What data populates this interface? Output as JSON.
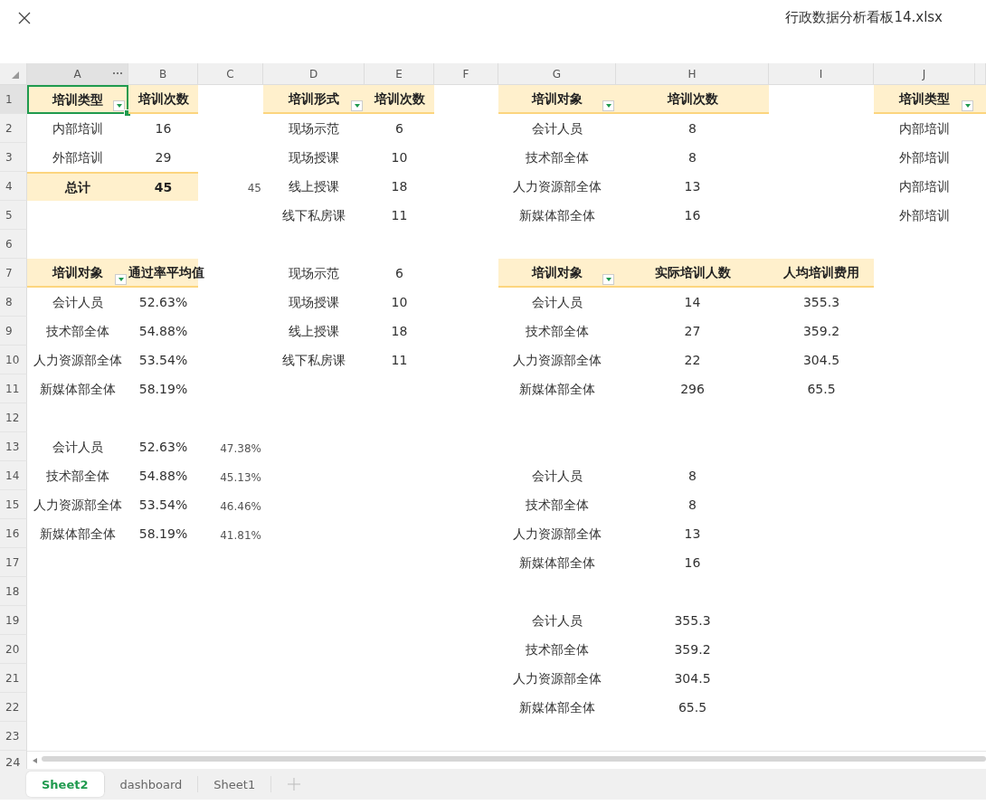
{
  "window": {
    "title": "行政数据分析看板14.xlsx"
  },
  "columns": [
    {
      "label": "A"
    },
    {
      "label": "B"
    },
    {
      "label": "C"
    },
    {
      "label": "D"
    },
    {
      "label": "E"
    },
    {
      "label": "F"
    },
    {
      "label": "G"
    },
    {
      "label": "H"
    },
    {
      "label": "I"
    },
    {
      "label": "J"
    },
    {}
  ],
  "rows": [
    {
      "label": "1",
      "cells": [
        {
          "kind": "header",
          "text": "培训类型",
          "filter": true,
          "selected": true
        },
        {
          "kind": "header",
          "text": "培训次数"
        },
        {},
        {
          "kind": "header",
          "text": "培训形式",
          "filter": true
        },
        {
          "kind": "header",
          "text": "培训次数"
        },
        {},
        {
          "kind": "header",
          "text": "培训对象",
          "filter": true
        },
        {
          "kind": "header",
          "text": "培训次数"
        },
        {},
        {
          "kind": "header",
          "text": "培训类型",
          "filter": true
        },
        {
          "kind": "header"
        }
      ]
    },
    {
      "label": "2",
      "cells": [
        {
          "kind": "text",
          "text": "内部培训"
        },
        {
          "kind": "text",
          "text": "16"
        },
        {},
        {
          "kind": "text",
          "text": "现场示范"
        },
        {
          "kind": "text",
          "text": "6"
        },
        {},
        {
          "kind": "text",
          "text": "会计人员"
        },
        {
          "kind": "text",
          "text": "8"
        },
        {},
        {
          "kind": "text",
          "text": "内部培训"
        },
        {}
      ]
    },
    {
      "label": "3",
      "cells": [
        {
          "kind": "text",
          "text": "外部培训"
        },
        {
          "kind": "text",
          "text": "29"
        },
        {},
        {
          "kind": "text",
          "text": "现场授课"
        },
        {
          "kind": "text",
          "text": "10"
        },
        {},
        {
          "kind": "text",
          "text": "技术部全体"
        },
        {
          "kind": "text",
          "text": "8"
        },
        {},
        {
          "kind": "text",
          "text": "外部培训"
        },
        {}
      ]
    },
    {
      "label": "4",
      "cells": [
        {
          "kind": "total",
          "text": "总计"
        },
        {
          "kind": "total",
          "text": "45"
        },
        {
          "kind": "small",
          "text": "45"
        },
        {
          "kind": "text",
          "text": "线上授课"
        },
        {
          "kind": "text",
          "text": "18"
        },
        {},
        {
          "kind": "text",
          "text": "人力资源部全体"
        },
        {
          "kind": "text",
          "text": "13"
        },
        {},
        {
          "kind": "text",
          "text": "内部培训"
        },
        {}
      ]
    },
    {
      "label": "5",
      "cells": [
        {},
        {},
        {},
        {
          "kind": "text",
          "text": "线下私房课"
        },
        {
          "kind": "text",
          "text": "11"
        },
        {},
        {
          "kind": "text",
          "text": "新媒体部全体"
        },
        {
          "kind": "text",
          "text": "16"
        },
        {},
        {
          "kind": "text",
          "text": "外部培训"
        },
        {}
      ]
    },
    {
      "label": "6",
      "cells": [
        {},
        {},
        {},
        {},
        {},
        {},
        {},
        {},
        {},
        {},
        {}
      ]
    },
    {
      "label": "7",
      "cells": [
        {
          "kind": "header",
          "text": "培训对象",
          "filter": true
        },
        {
          "kind": "header",
          "text": "通过率平均值",
          "overflow": true
        },
        {},
        {
          "kind": "text",
          "text": "现场示范"
        },
        {
          "kind": "text",
          "text": "6"
        },
        {},
        {
          "kind": "header",
          "text": "培训对象",
          "filter": true
        },
        {
          "kind": "header",
          "text": "实际培训人数"
        },
        {
          "kind": "header",
          "text": "人均培训费用"
        },
        {},
        {}
      ]
    },
    {
      "label": "8",
      "cells": [
        {
          "kind": "text",
          "text": "会计人员"
        },
        {
          "kind": "text",
          "text": "52.63%"
        },
        {},
        {
          "kind": "text",
          "text": "现场授课"
        },
        {
          "kind": "text",
          "text": "10"
        },
        {},
        {
          "kind": "text",
          "text": "会计人员"
        },
        {
          "kind": "text",
          "text": "14"
        },
        {
          "kind": "text",
          "text": "355.3"
        },
        {},
        {}
      ]
    },
    {
      "label": "9",
      "cells": [
        {
          "kind": "text",
          "text": "技术部全体"
        },
        {
          "kind": "text",
          "text": "54.88%"
        },
        {},
        {
          "kind": "text",
          "text": "线上授课"
        },
        {
          "kind": "text",
          "text": "18"
        },
        {},
        {
          "kind": "text",
          "text": "技术部全体"
        },
        {
          "kind": "text",
          "text": "27"
        },
        {
          "kind": "text",
          "text": "359.2"
        },
        {},
        {}
      ]
    },
    {
      "label": "10",
      "cells": [
        {
          "kind": "text",
          "text": "人力资源部全体"
        },
        {
          "kind": "text",
          "text": "53.54%"
        },
        {},
        {
          "kind": "text",
          "text": "线下私房课"
        },
        {
          "kind": "text",
          "text": "11"
        },
        {},
        {
          "kind": "text",
          "text": "人力资源部全体"
        },
        {
          "kind": "text",
          "text": "22"
        },
        {
          "kind": "text",
          "text": "304.5"
        },
        {},
        {}
      ]
    },
    {
      "label": "11",
      "cells": [
        {
          "kind": "text",
          "text": "新媒体部全体"
        },
        {
          "kind": "text",
          "text": "58.19%"
        },
        {},
        {},
        {},
        {},
        {
          "kind": "text",
          "text": "新媒体部全体"
        },
        {
          "kind": "text",
          "text": "296"
        },
        {
          "kind": "text",
          "text": "65.5"
        },
        {},
        {}
      ]
    },
    {
      "label": "12",
      "cells": [
        {},
        {},
        {},
        {},
        {},
        {},
        {},
        {},
        {},
        {},
        {}
      ]
    },
    {
      "label": "13",
      "cells": [
        {
          "kind": "text",
          "text": "会计人员"
        },
        {
          "kind": "text",
          "text": "52.63%"
        },
        {
          "kind": "small",
          "text": "47.38%"
        },
        {},
        {},
        {},
        {},
        {},
        {},
        {},
        {}
      ]
    },
    {
      "label": "14",
      "cells": [
        {
          "kind": "text",
          "text": "技术部全体"
        },
        {
          "kind": "text",
          "text": "54.88%"
        },
        {
          "kind": "small",
          "text": "45.13%"
        },
        {},
        {},
        {},
        {
          "kind": "text",
          "text": "会计人员"
        },
        {
          "kind": "text",
          "text": "8"
        },
        {},
        {},
        {}
      ]
    },
    {
      "label": "15",
      "cells": [
        {
          "kind": "text",
          "text": "人力资源部全体"
        },
        {
          "kind": "text",
          "text": "53.54%"
        },
        {
          "kind": "small",
          "text": "46.46%"
        },
        {},
        {},
        {},
        {
          "kind": "text",
          "text": "技术部全体"
        },
        {
          "kind": "text",
          "text": "8"
        },
        {},
        {},
        {}
      ]
    },
    {
      "label": "16",
      "cells": [
        {
          "kind": "text",
          "text": "新媒体部全体"
        },
        {
          "kind": "text",
          "text": "58.19%"
        },
        {
          "kind": "small",
          "text": "41.81%"
        },
        {},
        {},
        {},
        {
          "kind": "text",
          "text": "人力资源部全体"
        },
        {
          "kind": "text",
          "text": "13"
        },
        {},
        {},
        {}
      ]
    },
    {
      "label": "17",
      "cells": [
        {},
        {},
        {},
        {},
        {},
        {},
        {
          "kind": "text",
          "text": "新媒体部全体"
        },
        {
          "kind": "text",
          "text": "16"
        },
        {},
        {},
        {}
      ]
    },
    {
      "label": "18",
      "cells": [
        {},
        {},
        {},
        {},
        {},
        {},
        {},
        {},
        {},
        {},
        {}
      ]
    },
    {
      "label": "19",
      "cells": [
        {},
        {},
        {},
        {},
        {},
        {},
        {
          "kind": "text",
          "text": "会计人员"
        },
        {
          "kind": "text",
          "text": "355.3"
        },
        {},
        {},
        {}
      ]
    },
    {
      "label": "20",
      "cells": [
        {},
        {},
        {},
        {},
        {},
        {},
        {
          "kind": "text",
          "text": "技术部全体"
        },
        {
          "kind": "text",
          "text": "359.2"
        },
        {},
        {},
        {}
      ]
    },
    {
      "label": "21",
      "cells": [
        {},
        {},
        {},
        {},
        {},
        {},
        {
          "kind": "text",
          "text": "人力资源部全体"
        },
        {
          "kind": "text",
          "text": "304.5"
        },
        {},
        {},
        {}
      ]
    },
    {
      "label": "22",
      "cells": [
        {},
        {},
        {},
        {},
        {},
        {},
        {
          "kind": "text",
          "text": "新媒体部全体"
        },
        {
          "kind": "text",
          "text": "65.5"
        },
        {},
        {},
        {}
      ]
    },
    {
      "label": "23",
      "cells": [
        {},
        {},
        {},
        {},
        {},
        {},
        {},
        {},
        {},
        {},
        {}
      ]
    }
  ],
  "last_row": {
    "label": "24"
  },
  "sheet_tabs": [
    {
      "label": "Sheet2",
      "selected": true
    },
    {
      "label": "dashboard",
      "selected": false
    },
    {
      "label": "Sheet1",
      "selected": false
    }
  ]
}
